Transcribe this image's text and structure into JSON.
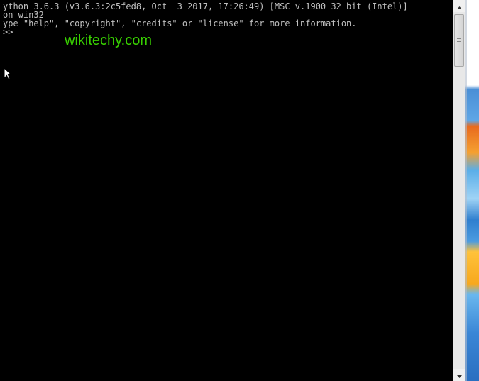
{
  "console": {
    "lines": [
      "ython 3.6.3 (v3.6.3:2c5fed8, Oct  3 2017, 17:26:49) [MSC v.1900 32 bit (Intel)]",
      "on win32",
      "ype \"help\", \"copyright\", \"credits\" or \"license\" for more information.",
      ">>"
    ],
    "text_color": "#c0c0c0",
    "background_color": "#000000"
  },
  "watermark": {
    "text": "wikitechy.com",
    "color": "#38d000"
  },
  "icons": {
    "cursor": "mouse-pointer-icon",
    "scroll_up": "arrow-up-icon",
    "scroll_down": "arrow-down-icon"
  }
}
